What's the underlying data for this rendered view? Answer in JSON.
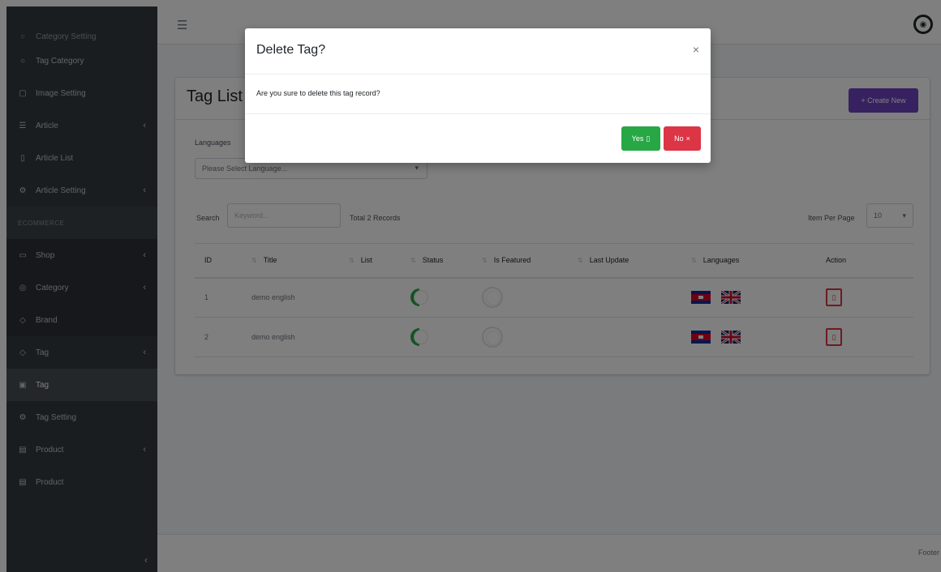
{
  "sidebar": {
    "top_item": "Category Setting",
    "items": [
      {
        "label": "Tag Category",
        "icon": "circle-icon"
      },
      {
        "label": "Image Setting",
        "icon": "image-icon"
      },
      {
        "label": "Article",
        "icon": "list-icon",
        "expandable": true
      },
      {
        "label": "Article List",
        "icon": "document-icon"
      },
      {
        "label": "Article Setting",
        "icon": "gear-icon",
        "expandable": true
      }
    ],
    "section_header": "ECOMMERCE",
    "items2": [
      {
        "label": "Shop",
        "icon": "shop-icon",
        "expandable": true
      },
      {
        "label": "Category",
        "icon": "folder-icon",
        "expandable": true
      },
      {
        "label": "Brand",
        "icon": "tag-icon"
      },
      {
        "label": "Tag",
        "icon": "tag-icon",
        "expandable": true
      },
      {
        "label": "Tag",
        "icon": "tag-icon",
        "active": true
      },
      {
        "label": "Tag Setting",
        "icon": "gear-icon"
      },
      {
        "label": "Product",
        "icon": "box-icon",
        "expandable": true
      },
      {
        "label": "Product",
        "icon": "box-icon"
      }
    ]
  },
  "page": {
    "title": "Tag List",
    "create_button": "+ Create New",
    "languages_label": "Languages",
    "language_placeholder": "Please Select Language...",
    "search_label": "Search",
    "search_placeholder": "Keyword...",
    "total_records": "Total 2 Records",
    "items_per_page_label": "Item Per Page",
    "items_per_page_value": "10"
  },
  "table": {
    "headers": [
      "ID",
      "Title",
      "List",
      "Status",
      "Is Featured",
      "Last Update",
      "Languages",
      "Action"
    ],
    "rows": [
      {
        "id": "1",
        "title": "demo english",
        "list": "",
        "status": true,
        "featured": false,
        "last_update": ""
      },
      {
        "id": "2",
        "title": "demo english",
        "list": "",
        "status": true,
        "featured": false,
        "last_update": ""
      }
    ]
  },
  "footer": {
    "text": "Footer"
  },
  "modal": {
    "title": "Delete Tag?",
    "close": "×",
    "message": "Are you sure to delete this tag record?",
    "yes_label": "Yes",
    "no_label": "No"
  },
  "colors": {
    "sidebar_bg": "#343a40",
    "primary": "#6f42c1",
    "success": "#28a745",
    "danger": "#dc3545"
  }
}
